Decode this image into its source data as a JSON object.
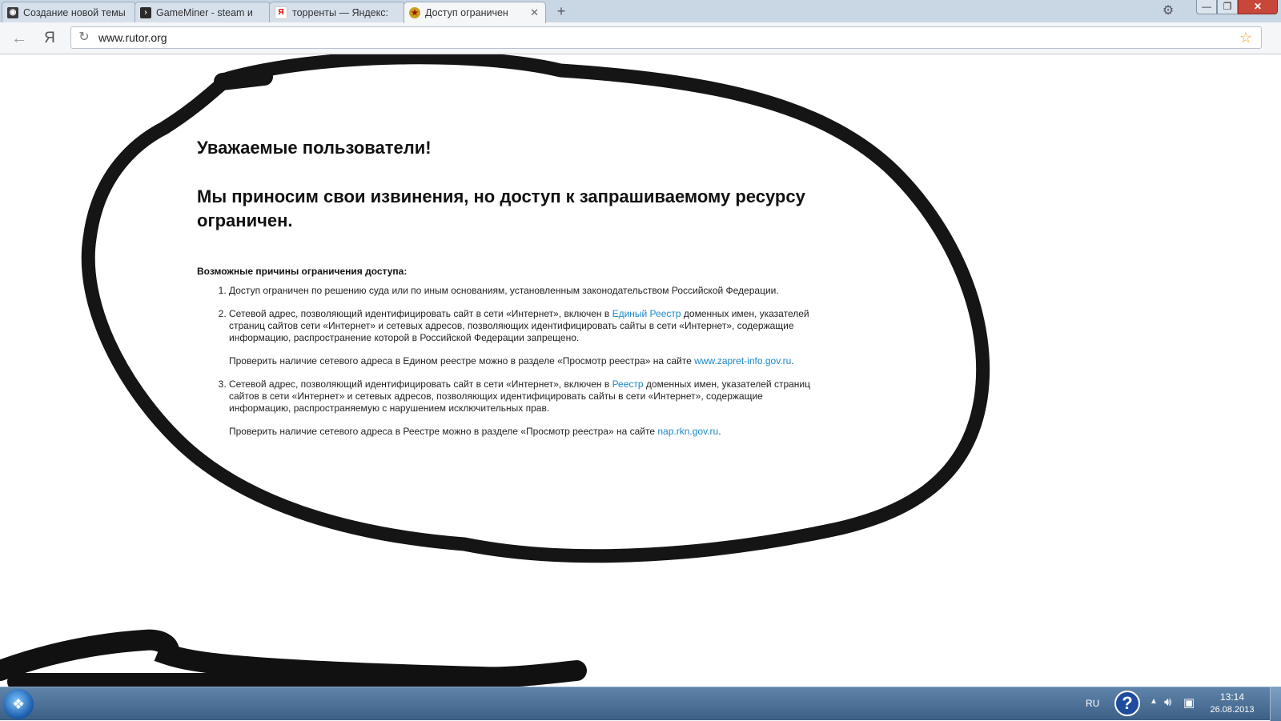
{
  "browser": {
    "tabs": [
      {
        "title": "Создание новой темы",
        "favicon": "forum-icon",
        "active": false
      },
      {
        "title": "GameMiner - steam и",
        "favicon": "gameminer-icon",
        "active": false
      },
      {
        "title": "торренты — Яндекс:",
        "favicon": "yandex-icon",
        "active": false
      },
      {
        "title": "Доступ ограничен",
        "favicon": "emblem-icon",
        "active": true
      }
    ],
    "new_tab_label": "+",
    "yandex_button": "Я",
    "url": "www.rutor.org",
    "window_controls": {
      "minimize": "—",
      "maximize": "❐",
      "close": "✕"
    }
  },
  "page": {
    "greeting": "Уважаемые пользователи!",
    "apology": "Мы приносим свои извинения, но доступ к запрашиваемому ресурсу ограничен.",
    "reasons_title": "Возможные причины ограничения доступа:",
    "reasons": [
      {
        "text": "Доступ ограничен  по решению суда или по иным основаниям, установленным законодательством Российской Федерации."
      },
      {
        "text_before_link": "Сетевой адрес, позволяющий идентифицировать сайт в сети «Интернет», включен в ",
        "link": "Единый Реестр",
        "text_after_link": " доменных имен, указателей страниц сайтов сети «Интернет» и сетевых адресов, позволяющих идентифицировать сайты в сети «Интернет», содержащие информацию, распространение которой в Российской Федерации запрещено.",
        "check_before_link": "Проверить наличие сетевого адреса в Едином реестре можно в разделе «Просмотр реестра» на сайте ",
        "check_link": "www.zapret-info.gov.ru",
        "check_after_link": "."
      },
      {
        "text_before_link": "Сетевой адрес, позволяющий идентифицировать сайт в сети «Интернет», включен в ",
        "link": "Реестр",
        "text_after_link": " доменных имен, указателей страниц сайтов в сети «Интернет» и сетевых адресов, позволяющих идентифицировать сайты в сети «Интернет», содержащие информацию, распространяемую с нарушением исключительных прав.",
        "check_before_link": "Проверить наличие сетевого адреса в Реестре можно в разделе «Просмотр реестра» на сайте ",
        "check_link": "nap.rkn.gov.ru",
        "check_after_link": "."
      }
    ],
    "link_color": "#1a88c8"
  },
  "taskbar": {
    "language": "RU",
    "time": "13:14",
    "date": "26.08.2013"
  }
}
